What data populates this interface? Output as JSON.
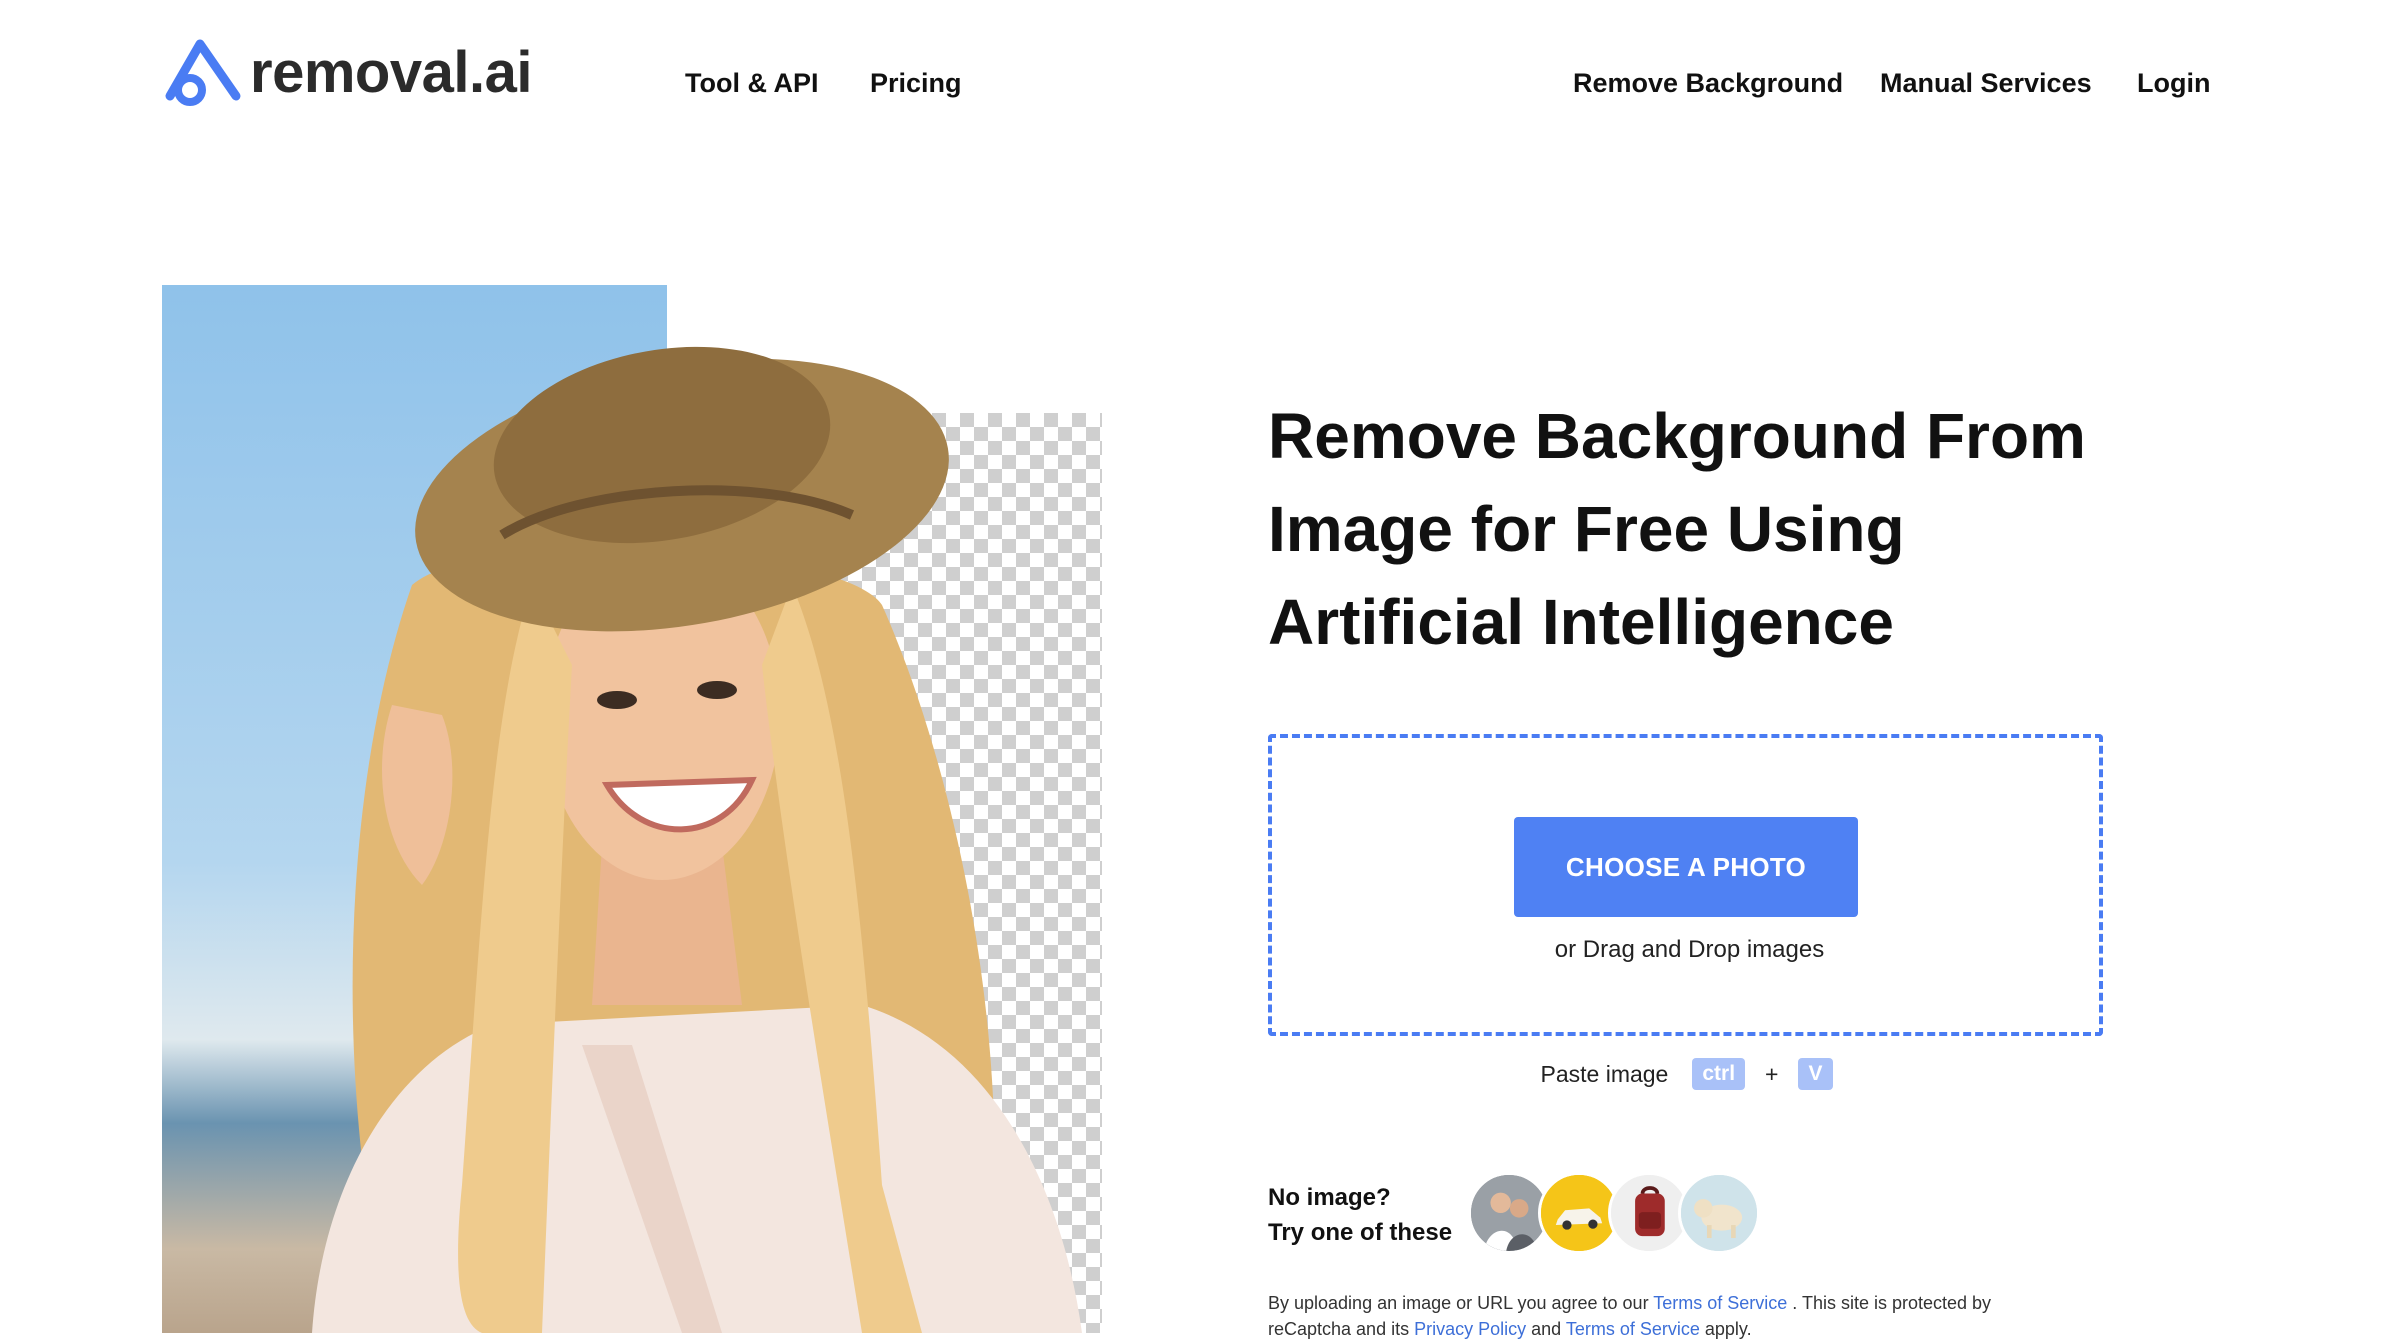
{
  "header": {
    "logo_text": "removal.ai",
    "nav_left": [
      "Tool & API",
      "Pricing"
    ],
    "nav_right": [
      "Remove Background",
      "Manual Services",
      "Login"
    ]
  },
  "hero": {
    "title_lines": [
      "Remove Background From",
      "Image for Free Using",
      "Artificial Intelligence"
    ],
    "upload": {
      "button_label": "CHOOSE A PHOTO",
      "drag_text": "or Drag and Drop images"
    },
    "paste": {
      "label": "Paste image",
      "key1": "ctrl",
      "plus": "+",
      "key2": "V"
    },
    "samples": {
      "line1": "No image?",
      "line2": "Try one of these",
      "items": [
        "people-sample",
        "car-sample",
        "backpack-sample",
        "dog-sample"
      ]
    },
    "legal": {
      "part1": "By uploading an image or URL you agree to our ",
      "link1": "Terms of Service",
      "part2": " . This site is protected by reCaptcha and its ",
      "link2": "Privacy Policy",
      "part3": " and ",
      "link3": "Terms of Service",
      "part4": " apply."
    }
  },
  "colors": {
    "accent": "#4f81f3",
    "dashed_border": "#4a7cf3",
    "kbd_bg": "#a9c1f8",
    "link": "#3d6fd8",
    "text": "#111111"
  }
}
